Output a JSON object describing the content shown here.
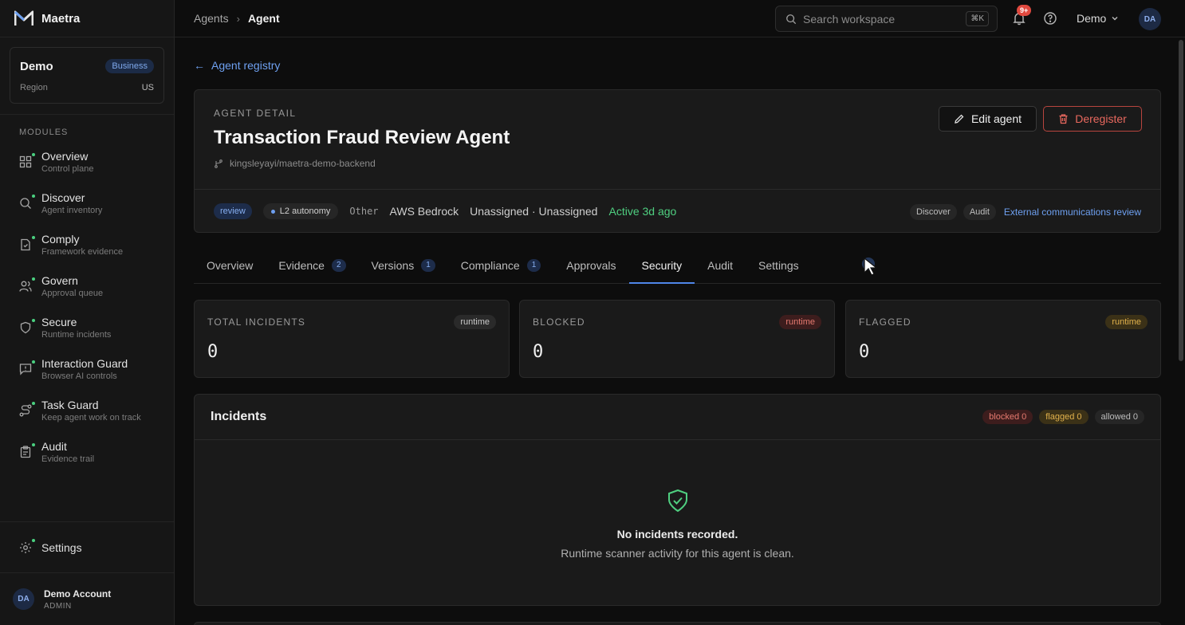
{
  "app": {
    "name": "Maetra"
  },
  "workspace": {
    "name": "Demo",
    "plan": "Business",
    "region_label": "Region",
    "region_value": "US"
  },
  "sidebar": {
    "section_label": "MODULES",
    "items": [
      {
        "title": "Overview",
        "sub": "Control plane",
        "icon": "grid-icon"
      },
      {
        "title": "Discover",
        "sub": "Agent inventory",
        "icon": "search-icon"
      },
      {
        "title": "Comply",
        "sub": "Framework evidence",
        "icon": "document-icon"
      },
      {
        "title": "Govern",
        "sub": "Approval queue",
        "icon": "users-icon"
      },
      {
        "title": "Secure",
        "sub": "Runtime incidents",
        "icon": "shield-icon"
      },
      {
        "title": "Interaction Guard",
        "sub": "Browser AI controls",
        "icon": "message-alert-icon"
      },
      {
        "title": "Task Guard",
        "sub": "Keep agent work on track",
        "icon": "route-icon"
      },
      {
        "title": "Audit",
        "sub": "Evidence trail",
        "icon": "clipboard-icon"
      }
    ],
    "settings_label": "Settings",
    "account": {
      "initials": "DA",
      "name": "Demo Account",
      "role": "ADMIN"
    }
  },
  "topbar": {
    "breadcrumb": [
      "Agents",
      "Agent"
    ],
    "search_placeholder": "Search workspace",
    "search_shortcut": "⌘K",
    "notifications": "9+",
    "workspace_switch": "Demo",
    "avatar_initials": "DA"
  },
  "back_link": "Agent registry",
  "agent": {
    "eyebrow": "AGENT DETAIL",
    "title": "Transaction Fraud Review Agent",
    "repo": "kingsleyayi/maetra-demo-backend",
    "edit_label": "Edit agent",
    "deregister_label": "Deregister",
    "meta": {
      "status_pill": "review",
      "autonomy": "L2 autonomy",
      "category": "Other",
      "provider": "AWS Bedrock",
      "owner": "Unassigned · Unassigned",
      "active": "Active 3d ago",
      "tags": [
        "Discover",
        "Audit"
      ],
      "link": "External communications review"
    }
  },
  "tabs": [
    {
      "label": "Overview",
      "count": ""
    },
    {
      "label": "Evidence",
      "count": "2"
    },
    {
      "label": "Versions",
      "count": "1"
    },
    {
      "label": "Compliance",
      "count": "1"
    },
    {
      "label": "Approvals",
      "count": ""
    },
    {
      "label": "Security",
      "count": ""
    },
    {
      "label": "Audit",
      "count": ""
    },
    {
      "label": "Settings",
      "count": ""
    }
  ],
  "active_tab": "Security",
  "stats": [
    {
      "label": "TOTAL INCIDENTS",
      "value": "0",
      "badge": "runtime",
      "tone": "gray"
    },
    {
      "label": "BLOCKED",
      "value": "0",
      "badge": "runtime",
      "tone": "red"
    },
    {
      "label": "FLAGGED",
      "value": "0",
      "badge": "runtime",
      "tone": "yellow"
    }
  ],
  "incidents": {
    "title": "Incidents",
    "badges": {
      "blocked": "blocked 0",
      "flagged": "flagged 0",
      "allowed": "allowed 0"
    },
    "empty_title": "No incidents recorded.",
    "empty_sub": "Runtime scanner activity for this agent is clean."
  },
  "colors": {
    "accent": "#4f86e8",
    "success": "#4fcf80",
    "danger": "#e8685e",
    "warning": "#e2b24c"
  }
}
